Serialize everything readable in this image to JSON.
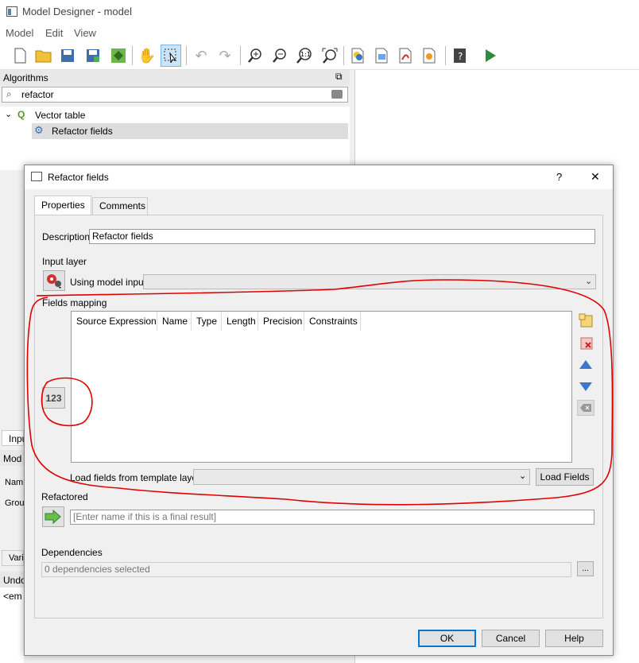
{
  "window": {
    "title": "Model Designer - model"
  },
  "menu": [
    "Model",
    "Edit",
    "View"
  ],
  "left_panel": {
    "header": "Algorithms",
    "search_value": "refactor",
    "tree": {
      "group": "Vector table",
      "item": "Refactor fields"
    },
    "stub_tabs": [
      "Inpu",
      "Mod",
      "Nam",
      "Grou",
      "Vari",
      "Undo",
      "<em"
    ]
  },
  "dialog": {
    "title": "Refactor fields",
    "help_glyph": "?",
    "close_glyph": "✕",
    "tabs": [
      "Properties",
      "Comments"
    ],
    "description_label": "Description",
    "description_value": "Refactor fields",
    "input_layer_label": "Input layer",
    "using_model_input": "Using model input",
    "fields_mapping_label": "Fields mapping",
    "columns": [
      "Source Expression",
      "Name",
      "Type",
      "Length",
      "Precision",
      "Constraints"
    ],
    "mode_button_label": "123",
    "load_fields_label": "Load fields from template layer",
    "load_fields_button": "Load Fields",
    "refactored_label": "Refactored",
    "refactored_placeholder": "[Enter name if this is a final result]",
    "dependencies_label": "Dependencies",
    "dependencies_value": "0 dependencies selected",
    "ellipsis": "...",
    "ok": "OK",
    "cancel": "Cancel",
    "help": "Help"
  },
  "colors": {
    "annotation": "#e00000",
    "accent": "#3f77c9",
    "ok_border": "#0078d7"
  }
}
